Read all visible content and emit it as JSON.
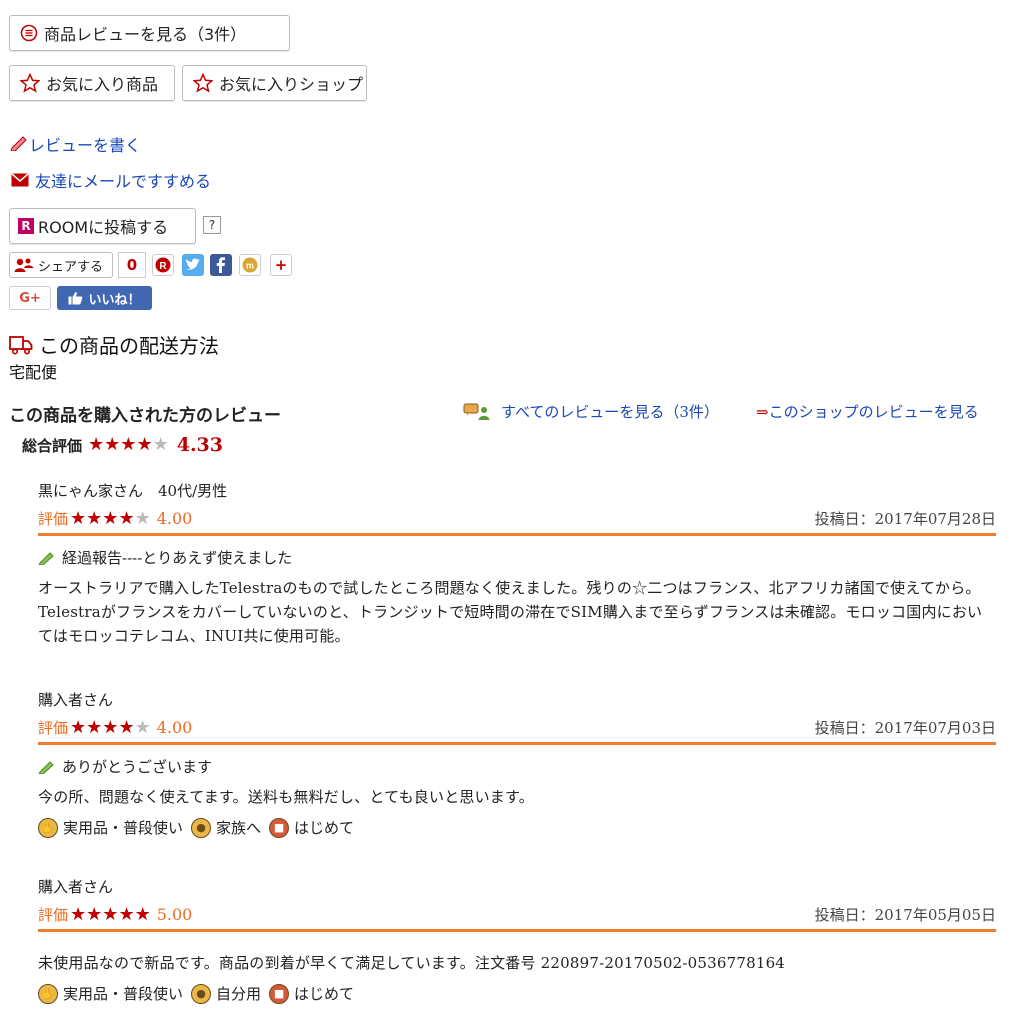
{
  "buttons": {
    "view_reviews": "商品レビューを見る（3件）",
    "fav_item": "お気に入り商品",
    "fav_shop": "お気に入りショップ",
    "room_post": "ROOMに投稿する",
    "room_help": "?",
    "share": "シェアする",
    "share_count": "0",
    "like": "いいね！",
    "gplus": "G+"
  },
  "links": {
    "write_review": "レビューを書く",
    "mail_friend": "友達にメールですすめる"
  },
  "shipping": {
    "title": "この商品の配送方法",
    "method": "宅配便"
  },
  "reviews_section": {
    "title": "この商品を購入された方のレビュー",
    "all_link": "すべてのレビューを見る（3件）",
    "shop_link_arrow": "⇒",
    "shop_link": "このショップのレビューを見る",
    "overall_label": "総合評価",
    "overall_score": "4.33",
    "overall_stars": 4.33
  },
  "reviews": [
    {
      "reviewer": "黒にゃん家さん　40代/男性",
      "rating_label": "評価",
      "rating": "4.00",
      "stars": 4,
      "date": "投稿日：2017年07月28日",
      "title": "経過報告----とりあえず使えました",
      "body": "オーストラリアで購入したTelestraのもので試したところ問題なく使えました。残りの☆二つはフランス、北アフリカ諸国で使えてから。Telestraがフランスをカバーしていないのと、トランジットで短時間の滞在でSIM購入まで至らずフランスは未確認。モロッコ国内においてはモロッコテレコム、INUI共に使用可能。"
    },
    {
      "reviewer": "購入者さん",
      "rating_label": "評価",
      "rating": "4.00",
      "stars": 4,
      "date": "投稿日：2017年07月03日",
      "title": "ありがとうございます",
      "body": "今の所、問題なく使えてます。送料も無料だし、とても良いと思います。",
      "tags": [
        "実用品・普段使い",
        "家族へ",
        "はじめて"
      ]
    },
    {
      "reviewer": "購入者さん",
      "rating_label": "評価",
      "rating": "5.00",
      "stars": 5,
      "date": "投稿日：2017年05月05日",
      "body": "未使用品なので新品です。商品の到着が早くて満足しています。注文番号 220897-20170502-0536778164",
      "tags": [
        "実用品・普段使い",
        "自分用",
        "はじめて"
      ]
    }
  ],
  "colors": {
    "link": "#1a47b8",
    "accent_red": "#bf0000",
    "rating_orange": "#ee6a1f"
  }
}
